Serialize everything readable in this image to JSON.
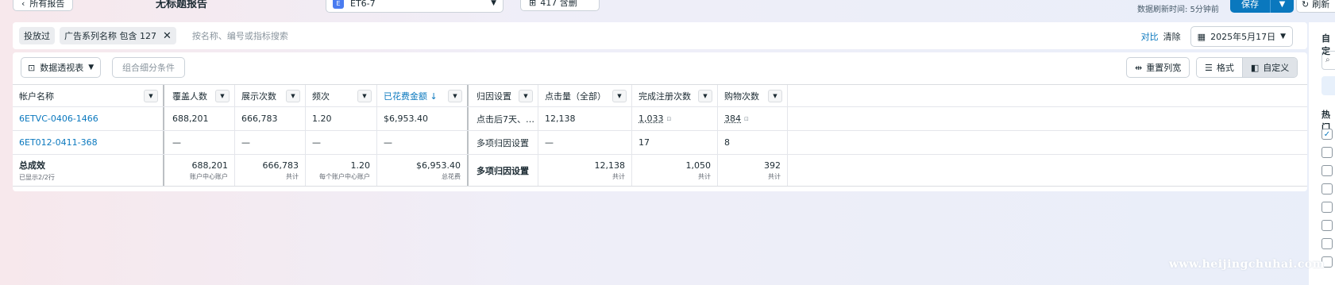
{
  "topbar": {
    "back_label": "所有报告",
    "report_title": "无标题报告",
    "account_badge": "E",
    "account_name": "ET6-7",
    "columns_label": "417 含删",
    "refresh_text": "数据刷新时间:  5分钟前",
    "save_label": "保存",
    "share_label": "刷新"
  },
  "filter": {
    "chip1": "投放过",
    "chip2": "广告系列名称 包含 127",
    "search_placeholder": "按名称、编号或指标搜索",
    "compare_label": "对比",
    "clear_label": "清除",
    "date_label": "2025年5月17日"
  },
  "toolbar": {
    "pivot_label": "数据透视表",
    "breakdown_label": "组合细分条件",
    "reset_label": "重置列宽",
    "format_label": "格式",
    "custom_label": "自定义"
  },
  "table": {
    "headers": [
      "帐户名称",
      "覆盖人数",
      "展示次数",
      "频次",
      "已花费金额 ↓",
      "归因设置",
      "点击量（全部）",
      "完成注册次数",
      "购物次数"
    ],
    "rows": [
      [
        "6ETVC-0406-1466",
        "688,201",
        "666,783",
        "1.20",
        "$6,953.40",
        "点击后7天、…",
        "12,138",
        "1,033",
        "384"
      ],
      [
        "6ET012-0411-368",
        "—",
        "—",
        "—",
        "—",
        "多项归因设置",
        "—",
        "17",
        "8"
      ]
    ],
    "total": {
      "label": "总成效",
      "sublabel": "已显示2/2行",
      "values": [
        "688,201",
        "666,783",
        "1.20",
        "$6,953.40",
        "多项归因设置",
        "12,138",
        "1,050",
        "392"
      ],
      "subs": [
        "账户中心账户",
        "共计",
        "每个账户中心账户",
        "总花费",
        "",
        "共计",
        "共计",
        "共计"
      ]
    }
  },
  "right_panel": {
    "title": "自定",
    "hot_label": "热门"
  },
  "watermark": "www.heijingchuhai.com",
  "colors": {
    "accent": "#0a78be",
    "link": "#0a78be"
  }
}
